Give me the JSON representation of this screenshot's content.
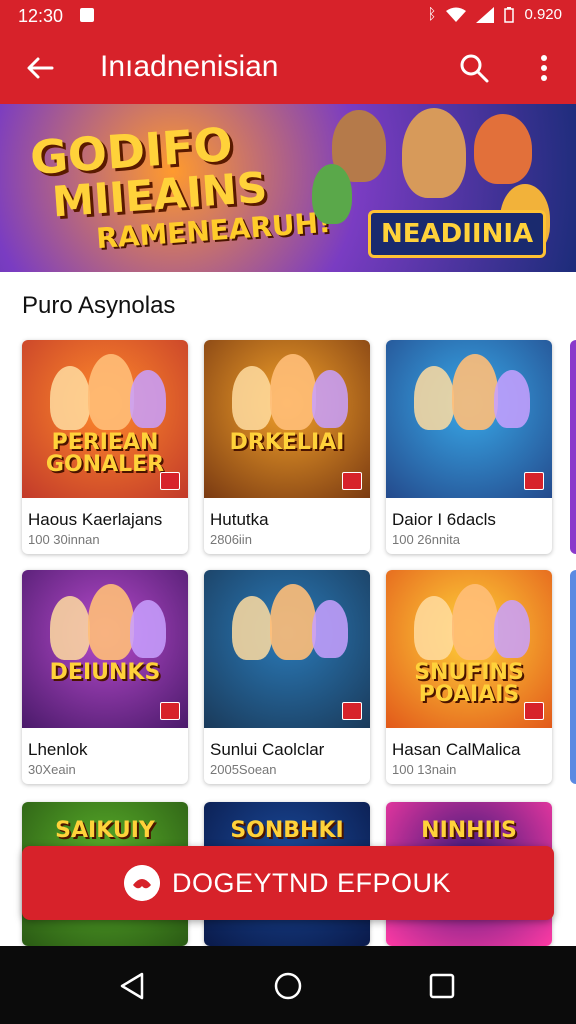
{
  "status": {
    "time": "12:30",
    "right": "0.920"
  },
  "appbar": {
    "title": "Inıadnenisian"
  },
  "banner": {
    "line1": "GODIFO",
    "line2": "MIIEAINS",
    "line3": "RAMENEARUH!",
    "badge": "NEADIINIA"
  },
  "section": {
    "title": "Puro Asynolas"
  },
  "games": [
    {
      "art": "PERIEAN GONALER",
      "name": "Haous Kaerlajans",
      "count": "100 30innan",
      "bg1": "#ff8a2b",
      "bg2": "#c23a2a"
    },
    {
      "art": "DRKELIAI",
      "name": "Hututka",
      "count": "2806iin",
      "bg1": "#f2a12a",
      "bg2": "#7a3a12"
    },
    {
      "art": "",
      "name": "Daior I 6dacls",
      "count": "100 26nnita",
      "bg1": "#38a8e8",
      "bg2": "#244a8c"
    },
    {
      "art": "DEIUNKS",
      "name": "Lhenlok",
      "count": "30Xeain",
      "bg1": "#b54acb",
      "bg2": "#4a1a6a"
    },
    {
      "art": "",
      "name": "Sunlui Caolclar",
      "count": "2005Soean",
      "bg1": "#2a7ab8",
      "bg2": "#1a3a5a"
    },
    {
      "art": "SNUFINS POAIAIS",
      "name": "Hasan CalMalica",
      "count": "100 13nain",
      "bg1": "#ffd23a",
      "bg2": "#e2591a"
    }
  ],
  "bottom_row": [
    {
      "art": "SAIKUIY",
      "bg1": "#5ab02a",
      "bg2": "#2a5a14"
    },
    {
      "art": "SONBHKI",
      "bg1": "#1a4a9a",
      "bg2": "#0a1a4a"
    },
    {
      "art": "NINHIIS",
      "bg1": "#3a1a7a",
      "bg2": "#ff3aa4"
    }
  ],
  "cta": {
    "label": "DOGEYTND EFPOUK"
  },
  "colors": {
    "brand": "#d7222a"
  }
}
